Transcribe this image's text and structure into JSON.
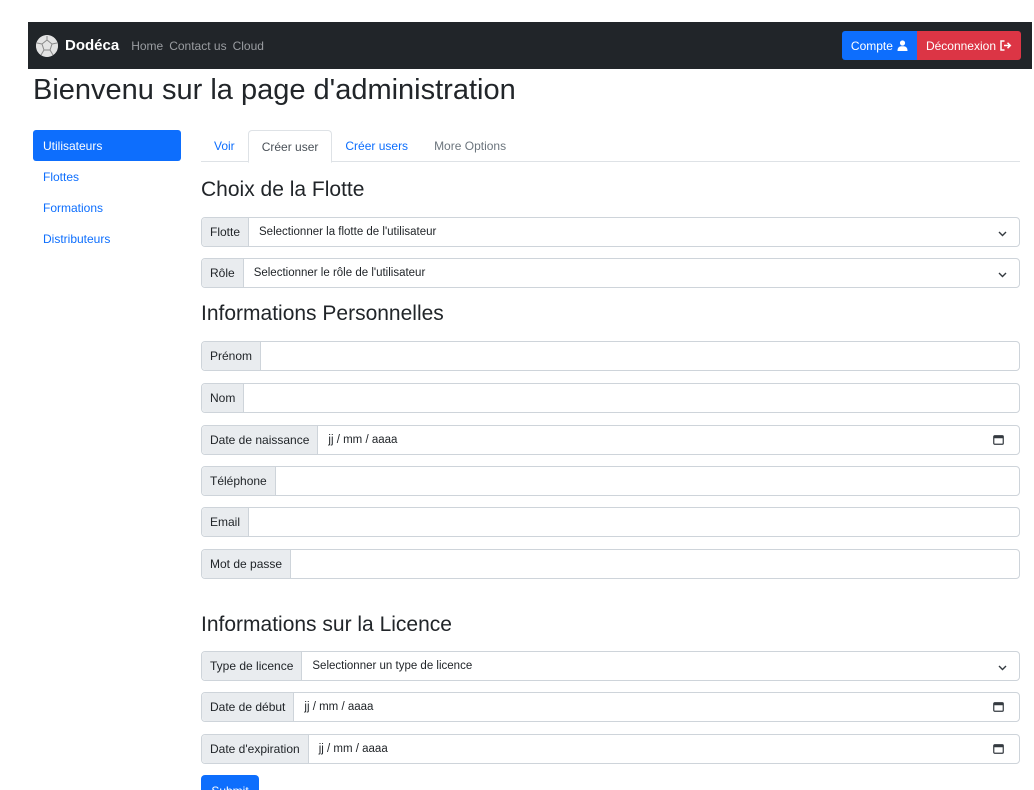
{
  "navbar": {
    "brand": "Dodéca",
    "links": [
      "Home",
      "Contact us",
      "Cloud"
    ],
    "account_label": "Compte",
    "logout_label": "Déconnexion"
  },
  "page_title": "Bienvenu sur la page d'administration",
  "sidebar": {
    "items": [
      "Utilisateurs",
      "Flottes",
      "Formations",
      "Distributeurs"
    ],
    "active": "Utilisateurs"
  },
  "tabs": {
    "items": [
      "Voir",
      "Créer user",
      "Créer users",
      "More Options"
    ],
    "active": "Créer user"
  },
  "fleet_section": {
    "title": "Choix de la Flotte",
    "fleet_label": "Flotte",
    "fleet_value": "Selectionner la flotte de l'utilisateur",
    "role_label": "Rôle",
    "role_value": "Selectionner le rôle de l'utilisateur"
  },
  "personal_section": {
    "title": "Informations Personnelles",
    "firstname_label": "Prénom",
    "lastname_label": "Nom",
    "birthdate_label": "Date de naissance",
    "birthdate_placeholder": "jj / mm / aaaa",
    "phone_label": "Téléphone",
    "email_label": "Email",
    "password_label": "Mot de passe"
  },
  "license_section": {
    "title": "Informations sur la Licence",
    "type_label": "Type de licence",
    "type_value": "Selectionner un type de licence",
    "start_label": "Date de début",
    "start_placeholder": "jj / mm / aaaa",
    "expiry_label": "Date d'expiration",
    "expiry_placeholder": "jj / mm / aaaa"
  },
  "submit_label": "Submit",
  "colors": {
    "primary": "#0d6efd",
    "danger": "#dc3545",
    "navbar": "#212529",
    "input_addon": "#e9ecef"
  },
  "icons": [
    "dodecahedron-logo-icon",
    "user-icon",
    "logout-icon",
    "chevron-down-icon",
    "calendar-icon"
  ]
}
